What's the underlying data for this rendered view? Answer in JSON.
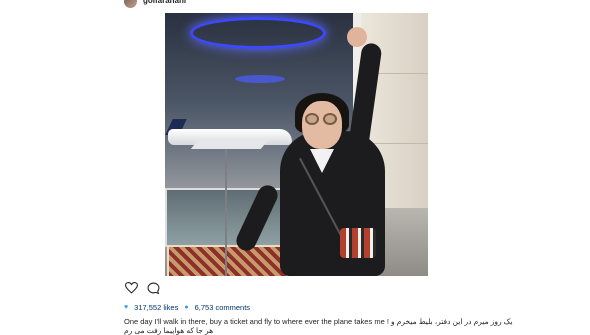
{
  "header": {
    "username": "golfarahani"
  },
  "post": {
    "likes_count": "317,552 likes",
    "comments_count": "6,753 comments",
    "caption_line1": "One day I'll walk in there, buy a ticket and fly to where ever the plane takes me ! یک روز میرم در این دفتر، بلیط میخرم و",
    "caption_line2": "هر جا که هواپیما رفت می رم"
  },
  "icons": {
    "like": "heart-outline-icon",
    "comment": "speech-bubble-icon"
  },
  "colors": {
    "link": "#003569",
    "accent": "#3897f0"
  }
}
